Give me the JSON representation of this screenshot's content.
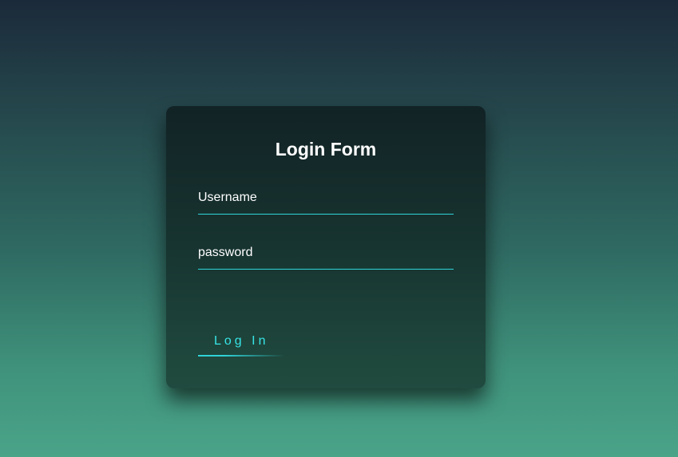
{
  "form": {
    "title": "Login Form",
    "username_label": "Username",
    "password_label": "password",
    "submit_label": "Log In"
  },
  "colors": {
    "accent": "#2fd3d8",
    "button_text": "#37e4e8",
    "card_bg": "rgba(0,0,0,0.5)"
  }
}
